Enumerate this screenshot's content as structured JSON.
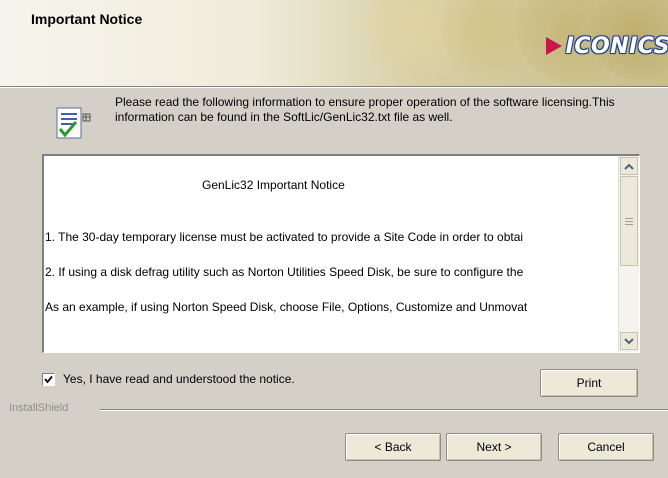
{
  "header": {
    "title": "Important Notice",
    "logo_text": "ICONICS"
  },
  "info": {
    "text": "Please read the following information to ensure proper operation of the software licensing.This information can be found in the SoftLic/GenLic32.txt file as well."
  },
  "notice": {
    "heading": "GenLic32 Important Notice",
    "lines": [
      "1. The 30-day temporary license must be activated to provide a Site Code in order to obtai",
      "2. If using a disk defrag utility such as Norton Utilities Speed Disk, be sure to configure the",
      "As an example, if using Norton Speed Disk, choose File, Options, Customize and Unmovat"
    ]
  },
  "acknowledge": {
    "label": "Yes, I have read and understood the notice.",
    "checked": true
  },
  "buttons": {
    "print": "Print",
    "back": "< Back",
    "next": "Next >",
    "cancel": "Cancel"
  },
  "footer": {
    "brand": "InstallShield"
  },
  "colors": {
    "dialog_bg": "#d4d0c8",
    "logo_arrow": "#c8184a",
    "logo_outline": "#1d3b8e"
  }
}
